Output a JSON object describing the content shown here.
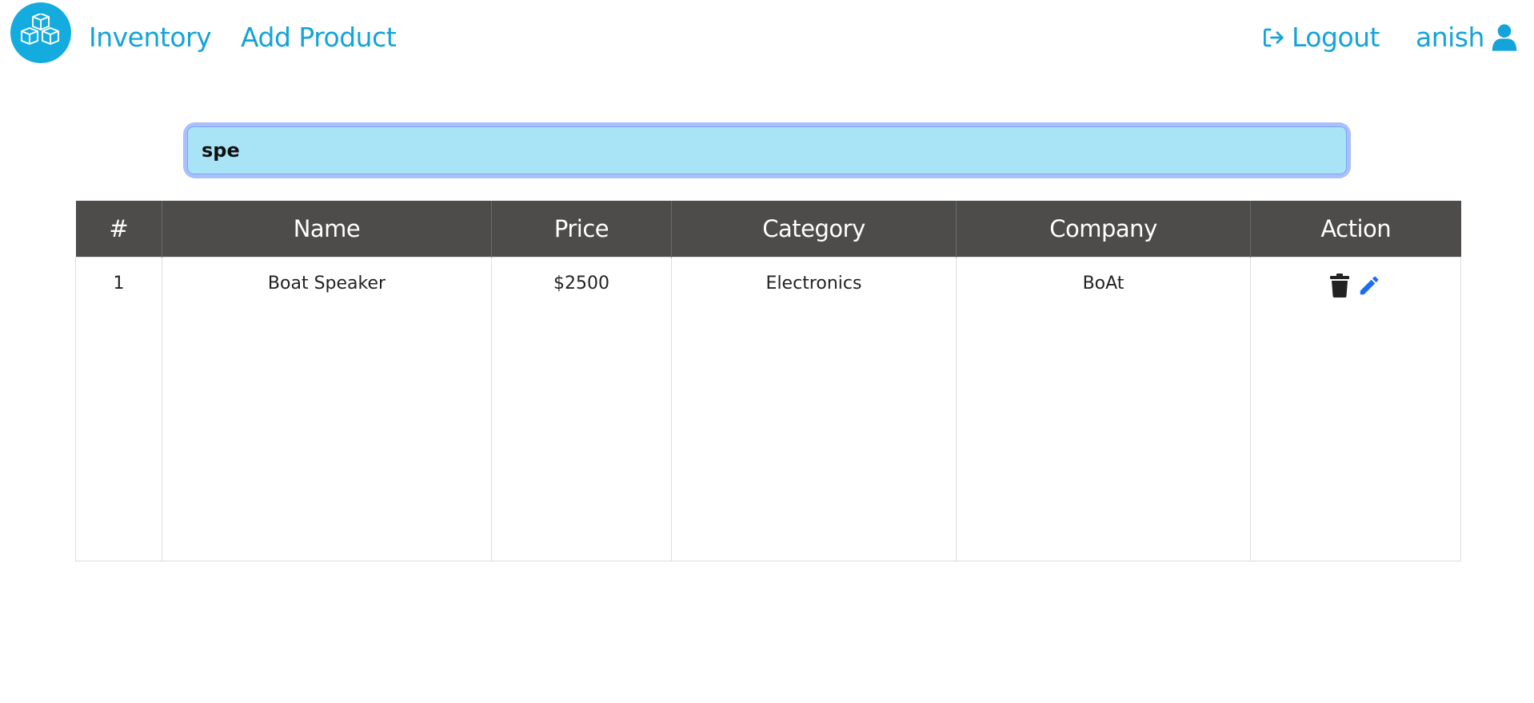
{
  "nav": {
    "logo_icon": "cubes-icon",
    "inventory_label": "Inventory",
    "add_product_label": "Add Product",
    "logout_label": "Logout",
    "logout_icon": "logout-icon",
    "user_name": "anish",
    "user_icon": "user-icon"
  },
  "search": {
    "value": "spe"
  },
  "table": {
    "headers": [
      "#",
      "Name",
      "Price",
      "Category",
      "Company",
      "Action"
    ],
    "rows": [
      {
        "index": "1",
        "name": "Boat Speaker",
        "price": "$2500",
        "category": "Electronics",
        "company": "BoAt",
        "actions": [
          "trash-icon",
          "pencil-icon"
        ]
      }
    ]
  },
  "colors": {
    "accent": "#14a3da",
    "header_bg": "#4d4c4b",
    "search_bg": "#a8e4f6",
    "edit_icon": "#1e6cf0"
  }
}
